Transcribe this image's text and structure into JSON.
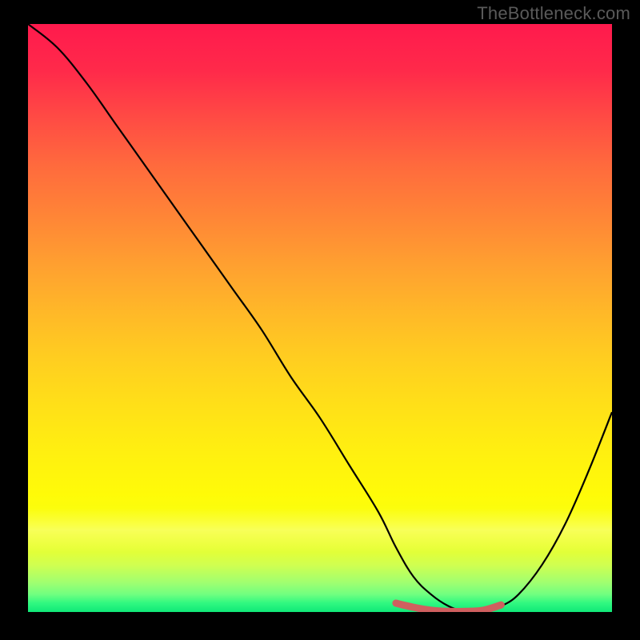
{
  "watermark": "TheBottleneck.com",
  "chart_data": {
    "type": "line",
    "title": "",
    "xlabel": "",
    "ylabel": "",
    "xlim": [
      0,
      100
    ],
    "ylim": [
      0,
      100
    ],
    "grid": false,
    "legend": false,
    "series": [
      {
        "name": "bottleneck-curve",
        "color": "#000000",
        "x": [
          0,
          5,
          10,
          15,
          20,
          25,
          30,
          35,
          40,
          45,
          50,
          55,
          60,
          63,
          66,
          69,
          72,
          75,
          78,
          81,
          84,
          88,
          92,
          96,
          100
        ],
        "y": [
          100,
          96,
          90,
          83,
          76,
          69,
          62,
          55,
          48,
          40,
          33,
          25,
          17,
          11,
          6,
          3,
          1,
          0,
          0,
          1,
          3,
          8,
          15,
          24,
          34
        ]
      },
      {
        "name": "optimal-band-marker",
        "color": "#d56a6a",
        "x": [
          63,
          66,
          69,
          72,
          75,
          78,
          81
        ],
        "y": [
          1.5,
          0.8,
          0.3,
          0.1,
          0.1,
          0.3,
          1.2
        ]
      }
    ],
    "background_gradient": {
      "top": "#ff1a4d",
      "mid": "#ffd320",
      "bottom": "#20e878"
    }
  }
}
